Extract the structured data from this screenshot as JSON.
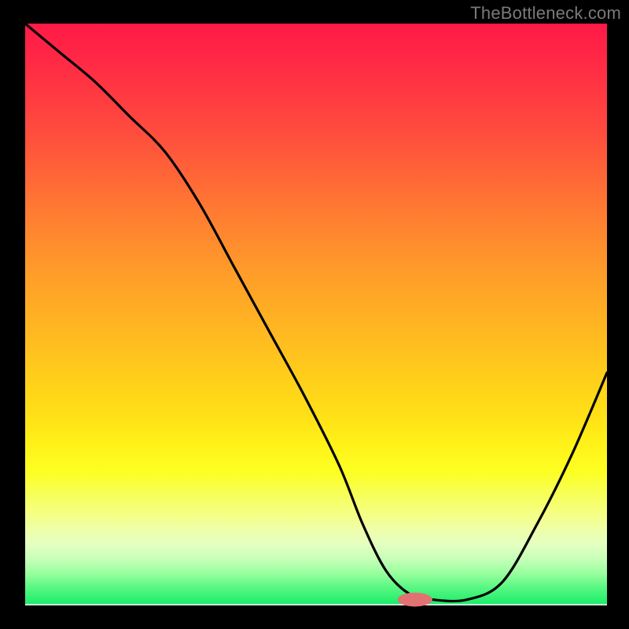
{
  "watermark": "TheBottleneck.com",
  "colors": {
    "frame": "#000000",
    "curve": "#000000",
    "marker": "#e27271",
    "gradient_top": "#ff1a47",
    "gradient_mid": "#ffdf17",
    "gradient_bottom": "#1bed6b"
  },
  "chart_data": {
    "type": "line",
    "title": "",
    "xlabel": "",
    "ylabel": "",
    "xlim": [
      0,
      100
    ],
    "ylim": [
      0,
      100
    ],
    "x": [
      0,
      6,
      12,
      18,
      24,
      30,
      36,
      42,
      48,
      54,
      58,
      62,
      66,
      70,
      76,
      82,
      88,
      94,
      100
    ],
    "values": [
      100,
      95,
      90,
      84,
      78,
      69,
      58,
      47,
      36,
      24,
      14,
      6,
      2,
      1,
      1,
      4,
      14,
      26,
      40
    ],
    "marker": {
      "x": 67,
      "y": 1,
      "rx": 3,
      "ry": 1.2
    },
    "note": "Values are approximate readings of the curve height relative to the plot area (100 = top, 0 = bottom). Axes and units are not labeled in the source image."
  }
}
